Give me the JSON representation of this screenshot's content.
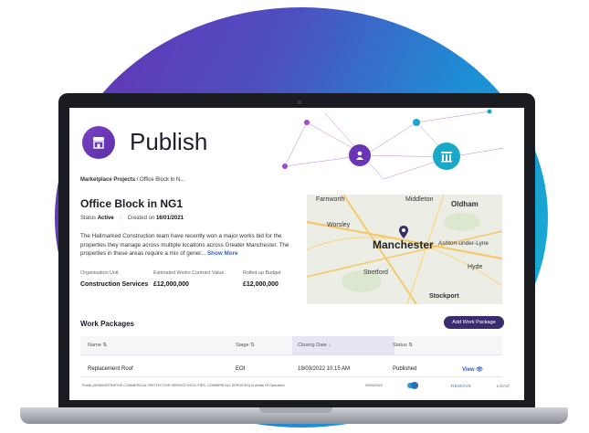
{
  "page": {
    "title": "Publish",
    "breadcrumb_root": "Marketplace Projects",
    "breadcrumb_sep": "/",
    "breadcrumb_current": "Office Block in N..."
  },
  "project": {
    "name": "Office Block in NG1",
    "status_label": "Status",
    "status_value": "Active",
    "created_label": "Created on",
    "created_value": "16/01/2021",
    "description": "The Hallmarked Construction team have recently won a major works bid for the properties they manage across multiple locations across Greater Manchester. The properties in these areas require a mix of gener...",
    "show_more": "Show More",
    "org_unit_label": "Organisation Unit",
    "org_unit_value": "Construction Services",
    "est_value_label": "Estimated Works Contract Value",
    "est_value_value": "£12,000,000",
    "budget_label": "Rolled-up Budget",
    "budget_value": "£12,000,000"
  },
  "map": {
    "labels": [
      "Farnworth",
      "Middleton",
      "Oldham",
      "Worsley",
      "Manchester",
      "Ashton-under-Lyne",
      "Hyde",
      "Stretford",
      "Stockport"
    ]
  },
  "work_packages": {
    "title": "Work Packages",
    "add_button": "Add Work Package",
    "columns": [
      "Name",
      "Stage",
      "Closing Date",
      "Status"
    ],
    "rows": [
      {
        "name": "Replacement Roof",
        "stage": "EOI",
        "closing": "19/03/2022 10:15 AM",
        "status": "Published",
        "action": "View"
      }
    ],
    "sub_row": {
      "text": "Public (ADMINISTRATIVE COMMERCIAL PROTECTIVE SERVICE FACILITIES, COMMERCIAL SERVICES) in Areas Of Operation",
      "date": "03/05/2022",
      "remove": "REMOVE",
      "load": "LOAD"
    }
  },
  "colors": {
    "accent": "#5a31a8",
    "button": "#3b2c6e",
    "link": "#2f5fc4",
    "teal": "#1aa8c9"
  }
}
